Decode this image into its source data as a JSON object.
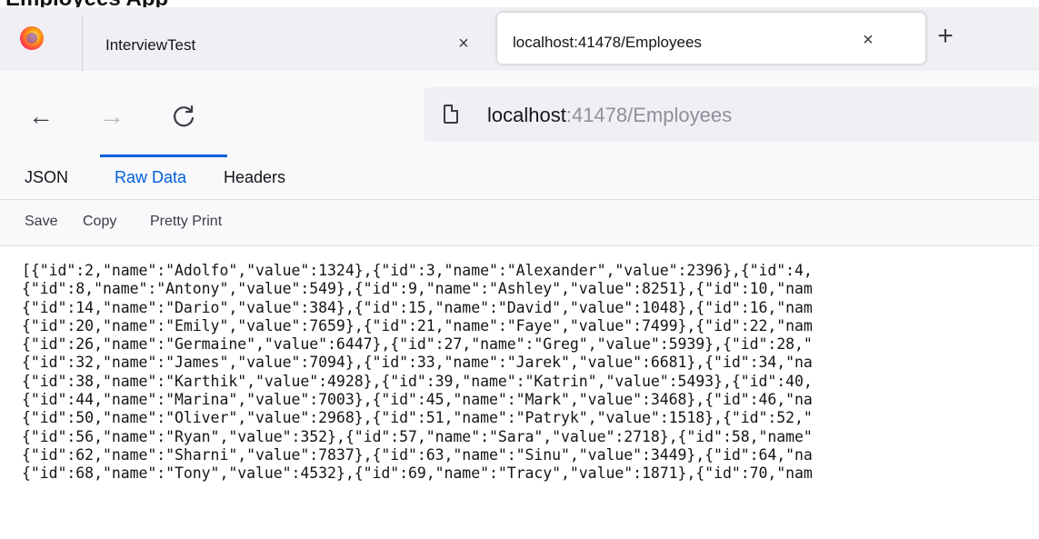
{
  "page_heading_fragment": "Employees App",
  "browser": {
    "tabs": [
      {
        "title": "InterviewTest",
        "close_glyph": "×",
        "active": false
      },
      {
        "title": "localhost:41478/Employees",
        "close_glyph": "×",
        "active": true
      }
    ],
    "new_tab_glyph": "+",
    "nav": {
      "back_glyph": "←",
      "forward_glyph": "→",
      "reload_glyph": "C"
    },
    "url": {
      "host": "localhost",
      "path": ":41478/Employees"
    }
  },
  "json_viewer": {
    "tabs": [
      "JSON",
      "Raw Data",
      "Headers"
    ],
    "active_tab": "Raw Data",
    "actions": [
      "Save",
      "Copy",
      "Pretty Print"
    ],
    "raw_lines": [
      "[{\"id\":2,\"name\":\"Adolfo\",\"value\":1324},{\"id\":3,\"name\":\"Alexander\",\"value\":2396},{\"id\":4,",
      "{\"id\":8,\"name\":\"Antony\",\"value\":549},{\"id\":9,\"name\":\"Ashley\",\"value\":8251},{\"id\":10,\"nam",
      "{\"id\":14,\"name\":\"Dario\",\"value\":384},{\"id\":15,\"name\":\"David\",\"value\":1048},{\"id\":16,\"nam",
      "{\"id\":20,\"name\":\"Emily\",\"value\":7659},{\"id\":21,\"name\":\"Faye\",\"value\":7499},{\"id\":22,\"nam",
      "{\"id\":26,\"name\":\"Germaine\",\"value\":6447},{\"id\":27,\"name\":\"Greg\",\"value\":5939},{\"id\":28,\"",
      "{\"id\":32,\"name\":\"James\",\"value\":7094},{\"id\":33,\"name\":\"Jarek\",\"value\":6681},{\"id\":34,\"na",
      "{\"id\":38,\"name\":\"Karthik\",\"value\":4928},{\"id\":39,\"name\":\"Katrin\",\"value\":5493},{\"id\":40,",
      "{\"id\":44,\"name\":\"Marina\",\"value\":7003},{\"id\":45,\"name\":\"Mark\",\"value\":3468},{\"id\":46,\"na",
      "{\"id\":50,\"name\":\"Oliver\",\"value\":2968},{\"id\":51,\"name\":\"Patryk\",\"value\":1518},{\"id\":52,\"",
      "{\"id\":56,\"name\":\"Ryan\",\"value\":352},{\"id\":57,\"name\":\"Sara\",\"value\":2718},{\"id\":58,\"name\"",
      "{\"id\":62,\"name\":\"Sharni\",\"value\":7837},{\"id\":63,\"name\":\"Sinu\",\"value\":3449},{\"id\":64,\"na",
      "{\"id\":68,\"name\":\"Tony\",\"value\":4532},{\"id\":69,\"name\":\"Tracy\",\"value\":1871},{\"id\":70,\"nam"
    ]
  },
  "colors": {
    "accent": "#0060df",
    "tabbar_bg": "#f0f0f4",
    "toolbar_bg": "#f9f9fb",
    "url_path": "#8f8f9d"
  },
  "icons": [
    "firefox-icon",
    "close-icon",
    "plus-icon",
    "back-arrow-icon",
    "forward-arrow-icon",
    "reload-icon",
    "page-icon"
  ]
}
